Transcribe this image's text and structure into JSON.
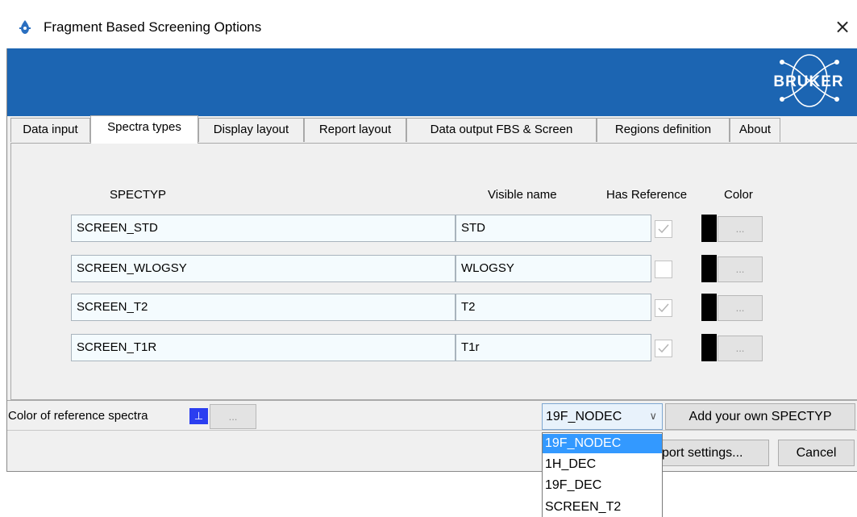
{
  "window": {
    "title": "Fragment Based Screening Options",
    "close_glyph": "×"
  },
  "banner": {
    "logo_text": "BRUKER",
    "color": "#1c65b2"
  },
  "tabs": [
    {
      "label": "Data input",
      "active": false
    },
    {
      "label": "Spectra types",
      "active": true
    },
    {
      "label": "Display layout",
      "active": false
    },
    {
      "label": "Report layout",
      "active": false
    },
    {
      "label": "Data output FBS & Screen",
      "active": false
    },
    {
      "label": "Regions definition",
      "active": false
    },
    {
      "label": "About",
      "active": false
    }
  ],
  "table": {
    "headers": {
      "spectyp": "SPECTYP",
      "visible_name": "Visible name",
      "has_reference": "Has Reference",
      "color": "Color"
    },
    "rows": [
      {
        "spectyp": "SCREEN_STD",
        "visible_name": "STD",
        "has_reference": true,
        "color": "#000000",
        "color_button": "..."
      },
      {
        "spectyp": "SCREEN_WLOGSY",
        "visible_name": "WLOGSY",
        "has_reference": false,
        "color": "#000000",
        "color_button": "..."
      },
      {
        "spectyp": "SCREEN_T2",
        "visible_name": "T2",
        "has_reference": true,
        "color": "#000000",
        "color_button": "..."
      },
      {
        "spectyp": "SCREEN_T1R",
        "visible_name": "T1r",
        "has_reference": true,
        "color": "#000000",
        "color_button": "..."
      }
    ]
  },
  "bottom": {
    "ref_label": "Color of reference spectra",
    "ref_swatch_glyph": "⊥",
    "ref_swatch_color": "#2b3ef0",
    "ref_button": "...",
    "combo_value": "19F_NODEC",
    "combo_arrow": "∨",
    "add_button": "Add your own SPECTYP",
    "export_button": "port settings...",
    "cancel_button": "Cancel"
  },
  "dropdown": {
    "options": [
      "19F_NODEC",
      "1H_DEC",
      "19F_DEC",
      "SCREEN_T2"
    ],
    "selected_index": 0,
    "highlight_color": "#3399ff"
  }
}
